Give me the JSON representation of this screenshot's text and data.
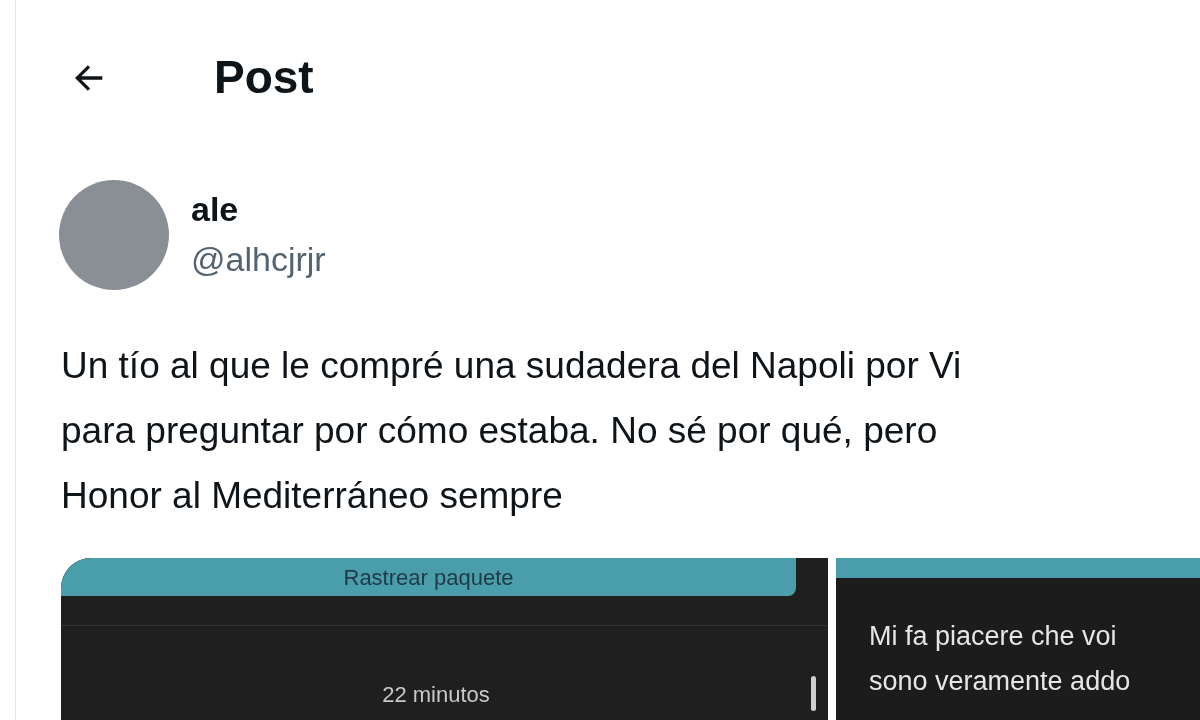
{
  "header": {
    "title": "Post"
  },
  "post": {
    "author_name": "ale",
    "author_handle": "@alhcjrjr",
    "text": "Un tío al que le compré una sudadera del Napoli por Vi\npara preguntar por cómo estaba. No sé por qué, pero\nHonor al Mediterráneo sempre",
    "media": [
      {
        "kind": "tracking",
        "button_label": "Rastrear paquete",
        "timestamp": "22 minutos"
      },
      {
        "kind": "message",
        "lines": [
          "Mi fa piacere che voi",
          "sono veramente addo"
        ]
      }
    ]
  }
}
